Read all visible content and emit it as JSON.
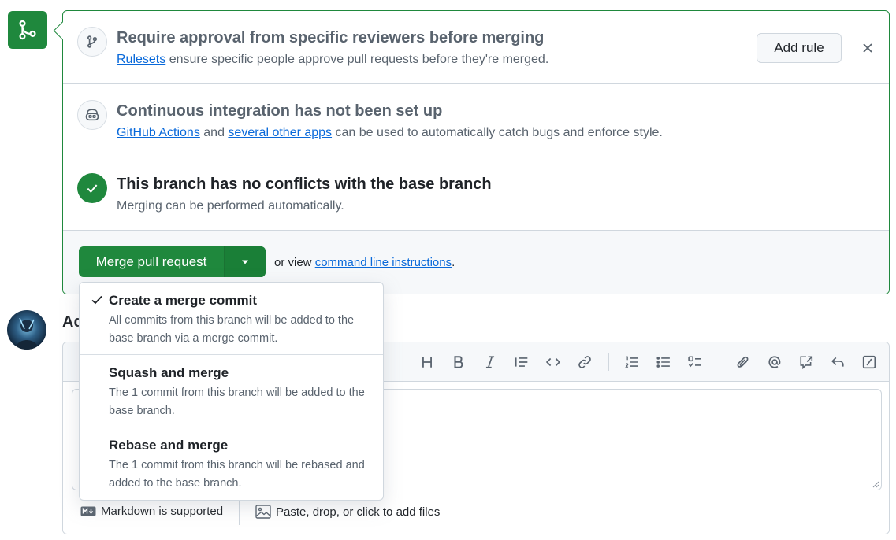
{
  "merge_box": {
    "ruleset": {
      "title": "Require approval from specific reviewers before merging",
      "link": "Rulesets",
      "desc": " ensure specific people approve pull requests before they're merged.",
      "add_rule_label": "Add rule"
    },
    "ci": {
      "title": "Continuous integration has not been set up",
      "link1": "GitHub Actions",
      "mid": " and ",
      "link2": "several other apps",
      "desc": " can be used to automatically catch bugs and enforce style."
    },
    "conflicts": {
      "title": "This branch has no conflicts with the base branch",
      "desc": "Merging can be performed automatically."
    },
    "footer": {
      "merge_label": "Merge pull request",
      "or_view": "or view ",
      "cli_link": "command line instructions",
      "period": "."
    }
  },
  "merge_menu": {
    "items": [
      {
        "title": "Create a merge commit",
        "desc": "All commits from this branch will be added to the base branch via a merge commit.",
        "selected": true
      },
      {
        "title": "Squash and merge",
        "desc": "The 1 commit from this branch will be added to the base branch.",
        "selected": false
      },
      {
        "title": "Rebase and merge",
        "desc": "The 1 commit from this branch will be rebased and added to the base branch.",
        "selected": false
      }
    ]
  },
  "comment": {
    "title_visible": "Ad",
    "markdown_note": "Markdown is supported",
    "paste_note": "Paste, drop, or click to add files"
  },
  "colors": {
    "accent_green": "#1f883d",
    "link_blue": "#0969da",
    "muted": "#59636e",
    "border": "#d0d7de"
  },
  "icons": {
    "merge_badge": "git-merge-icon",
    "ruleset": "git-branch-icon",
    "ci": "copilot-robot-icon",
    "conflicts": "check-icon"
  }
}
